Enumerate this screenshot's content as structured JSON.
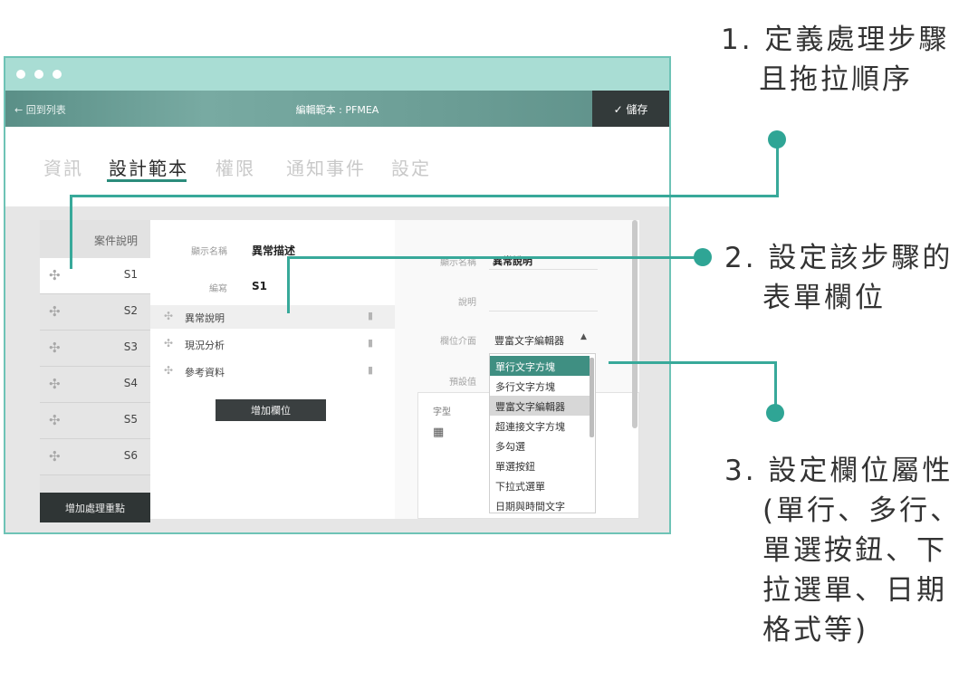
{
  "window": {
    "back_label": "← 回到列表",
    "title": "編輯範本 : PFMEA",
    "save_label": "✓ 儲存"
  },
  "tabs": [
    {
      "label": "資訊",
      "active": false
    },
    {
      "label": "設計範本",
      "active": true
    },
    {
      "label": "權限",
      "active": false
    },
    {
      "label": "通知事件",
      "active": false
    },
    {
      "label": "設定",
      "active": false
    }
  ],
  "steps": {
    "header": "案件說明",
    "items": [
      "S1",
      "S2",
      "S3",
      "S4",
      "S5",
      "S6"
    ],
    "active": "S1",
    "add_label": "增加處理重點"
  },
  "step_detail": {
    "display_name_label": "顯示名稱",
    "display_name_value": "異常描述",
    "code_label": "編寫",
    "code_value": "S1",
    "fields": [
      "異常說明",
      "現況分析",
      "參考資料"
    ],
    "add_field_label": "增加欄位"
  },
  "field_detail": {
    "display_name_label": "顯示名稱",
    "display_name_value": "異常說明",
    "desc_label": "說明",
    "type_label": "欄位介面",
    "type_value": "豐富文字編輯器",
    "default_label": "預設值",
    "font_label": "字型",
    "options": [
      "單行文字方塊",
      "多行文字方塊",
      "豐富文字編輯器",
      "超連接文字方塊",
      "多勾選",
      "單選按鈕",
      "下拉式選單",
      "日期與時間文字"
    ],
    "highlighted_option": "單行文字方塊",
    "current_option": "豐富文字編輯器"
  },
  "annotations": {
    "a1": [
      "1. 定義處理步驟",
      "且拖拉順序"
    ],
    "a2": [
      "2. 設定該步驟的",
      "表單欄位"
    ],
    "a3": [
      "3. 設定欄位屬性",
      "(單行、多行、",
      "單選按鈕、下",
      "拉選單、日期",
      "格式等)"
    ]
  },
  "colors": {
    "accent": "#2fa595",
    "frame": "#6ec3b6",
    "titlebar": "#a9ddd4"
  }
}
